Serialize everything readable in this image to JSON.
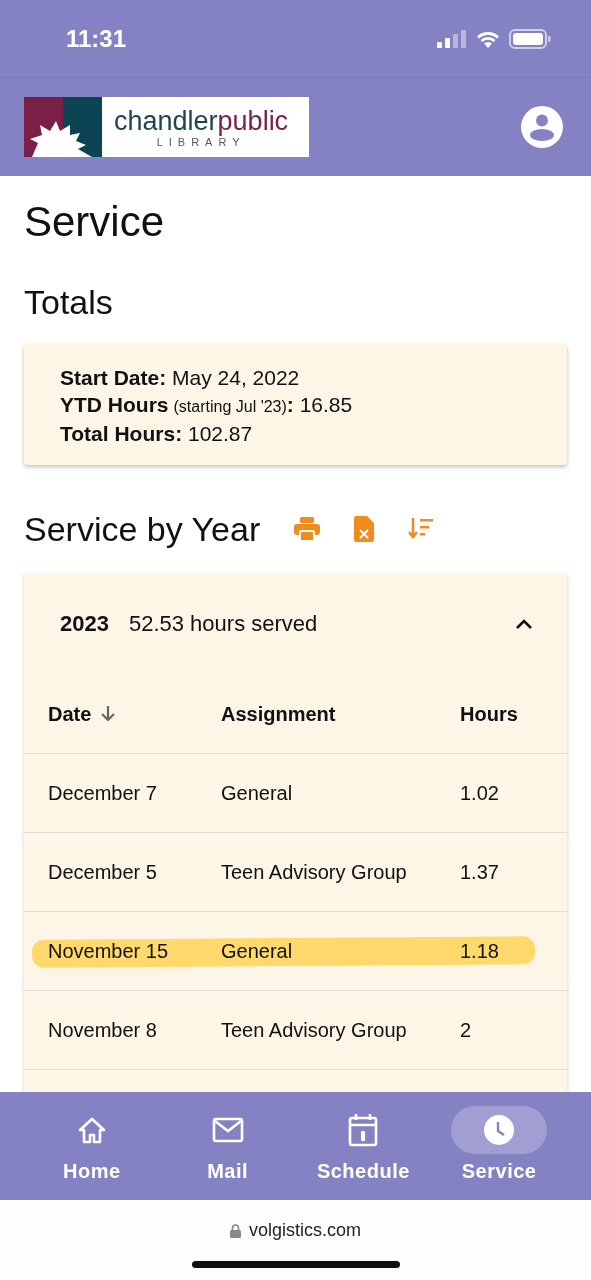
{
  "status_bar": {
    "time": "11:31"
  },
  "header": {
    "logo": {
      "text_1": "chandler",
      "text_2": "public",
      "subtitle": "LIBRARY"
    }
  },
  "page_title": "Service",
  "totals": {
    "title": "Totals",
    "lines": [
      {
        "label": "Start Date",
        "separator": ":",
        "value": "May 24, 2022"
      },
      {
        "label": "YTD Hours",
        "note": "(starting Jul '23)",
        "separator": ":",
        "value": "16.85"
      },
      {
        "label": "Total Hours",
        "separator": ":",
        "value": "102.87"
      }
    ]
  },
  "service_by_year": {
    "title": "Service by Year",
    "year_group": {
      "year": "2023",
      "summary": "52.53 hours served",
      "expanded": true,
      "columns": [
        {
          "label": "Date",
          "sorted": true
        },
        {
          "label": "Assignment",
          "sorted": false
        },
        {
          "label": "Hours",
          "sorted": false
        }
      ],
      "rows": [
        {
          "date": "December 7",
          "assignment": "General",
          "hours": "1.02",
          "highlighted": false
        },
        {
          "date": "December 5",
          "assignment": "Teen Advisory Group",
          "hours": "1.37",
          "highlighted": false
        },
        {
          "date": "November 15",
          "assignment": "General",
          "hours": "1.18",
          "highlighted": true
        },
        {
          "date": "November 8",
          "assignment": "Teen Advisory Group",
          "hours": "2",
          "highlighted": false
        }
      ]
    }
  },
  "bottom_nav": [
    {
      "kind": "home",
      "label": "Home",
      "selected": false
    },
    {
      "kind": "mail",
      "label": "Mail",
      "selected": false
    },
    {
      "kind": "calendar",
      "label": "Schedule",
      "selected": false
    },
    {
      "kind": "clock",
      "label": "Service",
      "selected": true
    }
  ],
  "browser": {
    "url": "volgistics.com"
  }
}
